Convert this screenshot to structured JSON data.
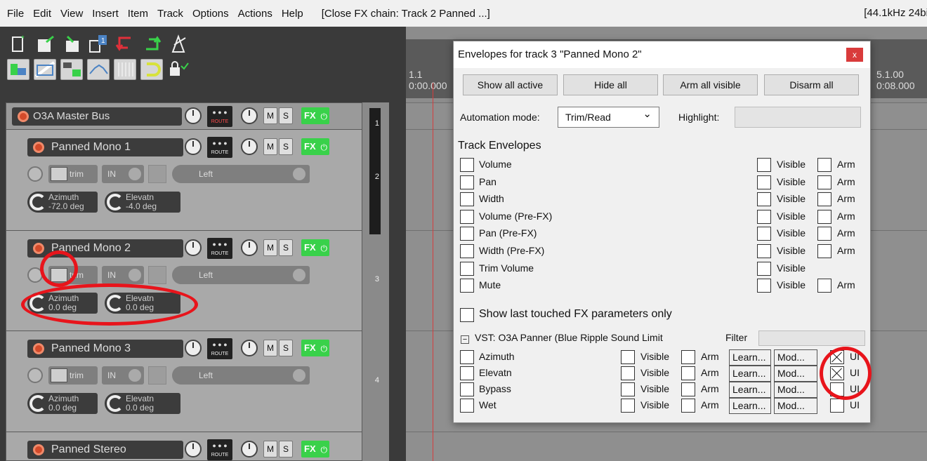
{
  "menu": {
    "items": [
      "File",
      "Edit",
      "View",
      "Insert",
      "Item",
      "Track",
      "Options",
      "Actions",
      "Help"
    ],
    "title": "[Close FX chain: Track 2 Panned ...]",
    "rate": "[44.1kHz 24bi"
  },
  "tracks": {
    "master": {
      "name": "O3A Master Bus",
      "route": "ROUTE",
      "m": "M",
      "s": "S",
      "fx": "FX",
      "power": "⏻"
    },
    "items": [
      {
        "name": "Panned Mono 1",
        "num": "2",
        "route": "ROUTE",
        "m": "M",
        "s": "S",
        "fx": "FX",
        "power": "⏻",
        "env": "trim",
        "in": "IN",
        "fxin": "Left",
        "p1": {
          "name": "Azimuth",
          "value": "-72.0 deg"
        },
        "p2": {
          "name": "Elevatn",
          "value": "-4.0 deg"
        }
      },
      {
        "name": "Panned Mono 2",
        "num": "3",
        "route": "ROUTE",
        "m": "M",
        "s": "S",
        "fx": "FX",
        "power": "⏻",
        "env": "trim",
        "in": "IN",
        "fxin": "Left",
        "p1": {
          "name": "Azimuth",
          "value": "0.0 deg"
        },
        "p2": {
          "name": "Elevatn",
          "value": "0.0 deg"
        }
      },
      {
        "name": "Panned Mono 3",
        "num": "4",
        "route": "ROUTE",
        "m": "M",
        "s": "S",
        "fx": "FX",
        "power": "⏻",
        "env": "trim",
        "in": "IN",
        "fxin": "Left",
        "p1": {
          "name": "Azimuth",
          "value": "0.0 deg"
        },
        "p2": {
          "name": "Elevatn",
          "value": "0.0 deg"
        }
      },
      {
        "name": "Panned Stereo",
        "route": "ROUTE",
        "m": "M",
        "s": "S",
        "fx": "FX",
        "power": "⏻"
      }
    ],
    "master_num": "1"
  },
  "ruler": {
    "start_bar": "1.1",
    "start_time": "0:00.000",
    "end_bar": "5.1.00",
    "end_time": "0:08.000"
  },
  "dialog": {
    "title": "Envelopes for track 3 \"Panned Mono 2\"",
    "close": "x",
    "buttons": [
      "Show all active",
      "Hide all",
      "Arm all visible",
      "Disarm all"
    ],
    "automation_label": "Automation mode:",
    "automation_value": "Trim/Read",
    "highlight_label": "Highlight:",
    "track_env_title": "Track Envelopes",
    "visible": "Visible",
    "arm": "Arm",
    "track_envelopes": [
      {
        "name": "Volume",
        "arm": true
      },
      {
        "name": "Pan",
        "arm": true
      },
      {
        "name": "Width",
        "arm": true
      },
      {
        "name": "Volume (Pre-FX)",
        "arm": true
      },
      {
        "name": "Pan (Pre-FX)",
        "arm": true
      },
      {
        "name": "Width (Pre-FX)",
        "arm": true
      },
      {
        "name": "Trim Volume",
        "arm": false
      },
      {
        "name": "Mute",
        "arm": true
      }
    ],
    "show_last_touched": "Show last touched FX parameters only",
    "vst_title": "VST: O3A Panner (Blue Ripple Sound Limit",
    "filter_label": "Filter",
    "minus": "−",
    "learn": "Learn...",
    "mod": "Mod...",
    "ui": "UI",
    "fx_params": [
      {
        "name": "Azimuth",
        "ui_checked": true
      },
      {
        "name": "Elevatn",
        "ui_checked": true
      },
      {
        "name": "Bypass",
        "ui_checked": false
      },
      {
        "name": "Wet",
        "ui_checked": false
      }
    ]
  },
  "colors": {
    "annotation": "#e8141b",
    "fx_green": "#39d14a",
    "close_red": "#d93b3b"
  }
}
